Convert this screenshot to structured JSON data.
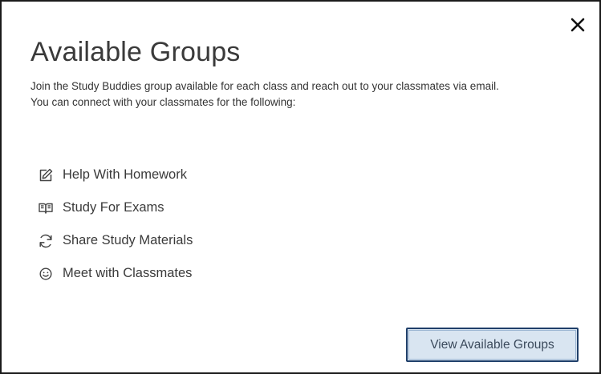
{
  "modal": {
    "title": "Available Groups",
    "description_line1": "Join the Study Buddies group available for each class and reach out to your classmates via email.",
    "description_line2": "You can connect with your classmates for the following:",
    "close_icon": "close-icon",
    "benefits": [
      {
        "label": "Help With Homework",
        "icon": "edit-icon"
      },
      {
        "label": "Study For Exams",
        "icon": "book-icon"
      },
      {
        "label": "Share Study Materials",
        "icon": "refresh-icon"
      },
      {
        "label": "Meet with Classmates",
        "icon": "smiley-icon"
      }
    ],
    "primary_button_label": "View Available Groups",
    "colors": {
      "button_background": "#d9e5f1",
      "button_border": "#1f3f6a",
      "text": "#333333"
    }
  }
}
